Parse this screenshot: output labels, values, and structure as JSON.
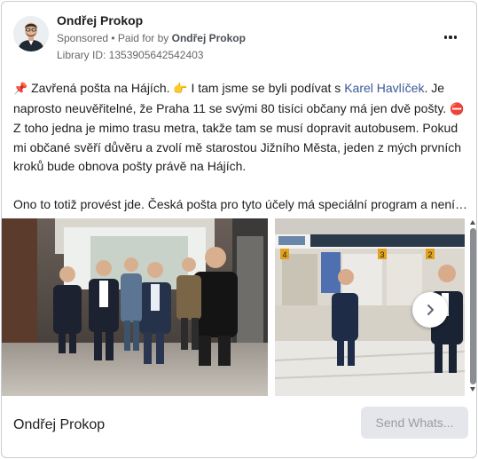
{
  "header": {
    "page_name": "Ondřej Prokop",
    "sponsored_label": "Sponsored",
    "separator": " • ",
    "paid_for_label": "Paid for by ",
    "paid_for_name": "Ondřej Prokop",
    "library_id": "Library ID: 1353905642542403"
  },
  "post": {
    "line1_emoji": "📌",
    "line1_a": " Zavřená pošta na Hájích. ",
    "line1_emoji2": "👉",
    "line1_b": " I tam jsme se byli podívat s ",
    "mention": "Karel Havlíček",
    "line1_c": ". Je",
    "line2": "naprosto neuvěřitelné, že Praha 11 se svými 80 tisíci občany má jen dvě pošty. ",
    "line2_emoji": "⛔",
    "line3": "Z toho jedna je mimo trasu metra, takže tam se musí dopravit autobusem. Pokud",
    "line4": "mi občané svěří důvěru a zvolí mě starostou Jižního Města, jeden z mých prvních",
    "line5": "kroků bude obnova pošty právě na Hájích.",
    "line6": "Ono to totiž provést jde. Česká pošta pro tyto účely má speciální program a není t…"
  },
  "carousel": {
    "photo1_icon": "group-walking-photo",
    "photo2_icon": "post-office-counter-photo",
    "counter_numbers": [
      "4",
      "3",
      "2"
    ]
  },
  "footer": {
    "name": "Ondřej Prokop",
    "cta_label": "Send Whats..."
  }
}
